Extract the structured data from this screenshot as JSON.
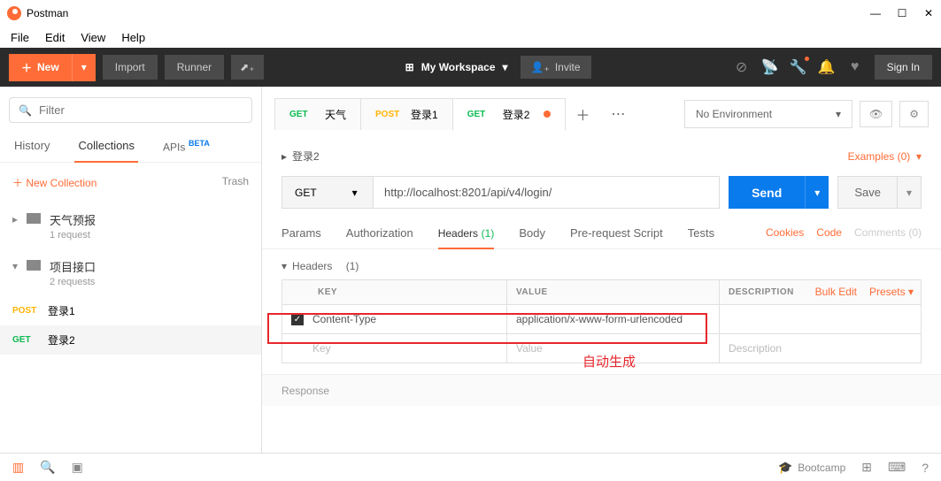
{
  "app": {
    "title": "Postman"
  },
  "menu": {
    "file": "File",
    "edit": "Edit",
    "view": "View",
    "help": "Help"
  },
  "toolbar": {
    "new": "New",
    "import": "Import",
    "runner": "Runner",
    "workspace": "My Workspace",
    "invite": "Invite",
    "signin": "Sign In"
  },
  "sidebar": {
    "filter_placeholder": "Filter",
    "tabs": {
      "history": "History",
      "collections": "Collections",
      "apis": "APIs",
      "beta": "BETA"
    },
    "new_collection": "New Collection",
    "trash": "Trash",
    "folders": [
      {
        "name": "天气预报",
        "count": "1 request"
      },
      {
        "name": "项目接口",
        "count": "2 requests"
      }
    ],
    "requests": [
      {
        "method": "POST",
        "name": "登录1"
      },
      {
        "method": "GET",
        "name": "登录2"
      }
    ]
  },
  "tabs": [
    {
      "method": "GET",
      "name": "天气"
    },
    {
      "method": "POST",
      "name": "登录1"
    },
    {
      "method": "GET",
      "name": "登录2",
      "dirty": true
    }
  ],
  "env": {
    "selected": "No Environment"
  },
  "request": {
    "name": "登录2",
    "examples": "Examples (0)",
    "method": "GET",
    "url": "http://localhost:8201/api/v4/login/",
    "send": "Send",
    "save": "Save",
    "tabs": {
      "params": "Params",
      "auth": "Authorization",
      "headers": "Headers",
      "headers_count": "(1)",
      "body": "Body",
      "prereq": "Pre-request Script",
      "tests": "Tests"
    },
    "links": {
      "cookies": "Cookies",
      "code": "Code",
      "comments": "Comments (0)"
    }
  },
  "headers": {
    "title": "Headers",
    "count": "(1)",
    "cols": {
      "key": "KEY",
      "value": "VALUE",
      "desc": "DESCRIPTION"
    },
    "actions": {
      "bulk": "Bulk Edit",
      "presets": "Presets"
    },
    "rows": [
      {
        "key": "Content-Type",
        "value": "application/x-www-form-urlencoded",
        "checked": true
      }
    ],
    "placeholder": {
      "key": "Key",
      "value": "Value",
      "desc": "Description"
    }
  },
  "annotation": "自动生成",
  "response": {
    "label": "Response"
  },
  "statusbar": {
    "bootcamp": "Bootcamp"
  }
}
